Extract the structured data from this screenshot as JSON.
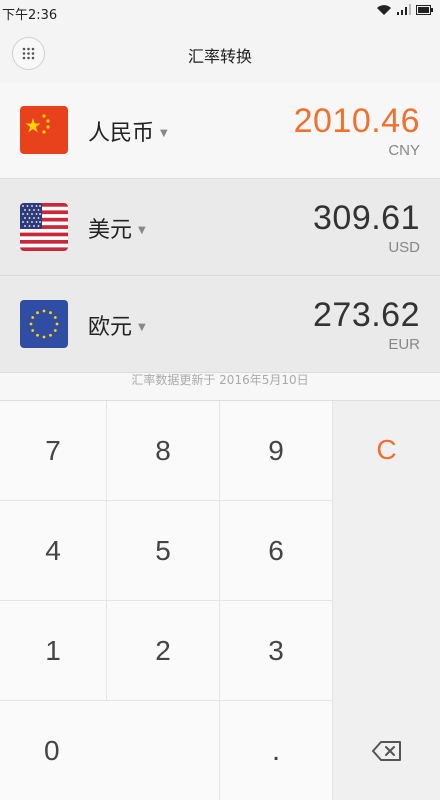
{
  "status": {
    "time": "下午2:36"
  },
  "header": {
    "title": "汇率转换"
  },
  "currencies": [
    {
      "name": "人民币",
      "amount": "2010.46",
      "code": "CNY"
    },
    {
      "name": "美元",
      "amount": "309.61",
      "code": "USD"
    },
    {
      "name": "欧元",
      "amount": "273.62",
      "code": "EUR"
    }
  ],
  "update_text": "汇率数据更新于 2016年5月10日",
  "keypad": {
    "k7": "7",
    "k8": "8",
    "k9": "9",
    "clear": "C",
    "k4": "4",
    "k5": "5",
    "k6": "6",
    "k1": "1",
    "k2": "2",
    "k3": "3",
    "k0": "0",
    "dot": "."
  },
  "colors": {
    "accent": "#f07030"
  }
}
